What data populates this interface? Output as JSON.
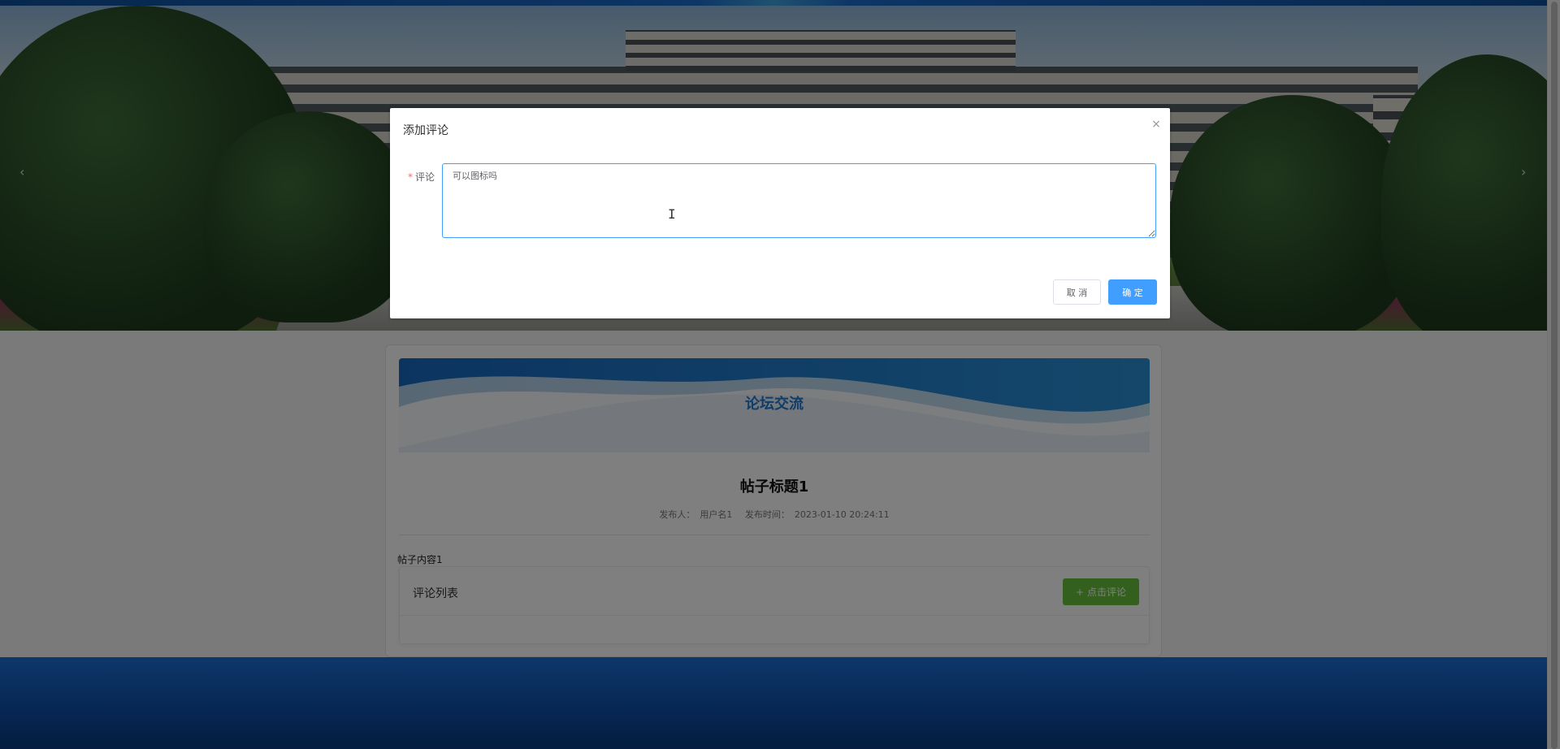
{
  "carousel": {
    "prev_arrow": "‹",
    "next_arrow": "›"
  },
  "forum": {
    "section_title": "论坛交流",
    "post_title": "帖子标题1",
    "meta": {
      "publisher_label": "发布人：",
      "publisher": "用户名1",
      "time_label": "发布时间：",
      "time": "2023-01-10 20:24:11"
    },
    "content": "帖子内容1",
    "comments_title": "评论列表",
    "add_comment_label": "点击评论",
    "add_comment_icon": "+"
  },
  "dialog": {
    "title": "添加评论",
    "close_icon": "×",
    "field_required_mark": "*",
    "field_label": "评论",
    "textarea_value": "可以图标吗",
    "cancel_label": "取 消",
    "confirm_label": "确 定"
  },
  "colors": {
    "primary": "#409eff",
    "success": "#67c23a",
    "section_title": "#1f7ad0",
    "footer": "#0d4fa8"
  }
}
